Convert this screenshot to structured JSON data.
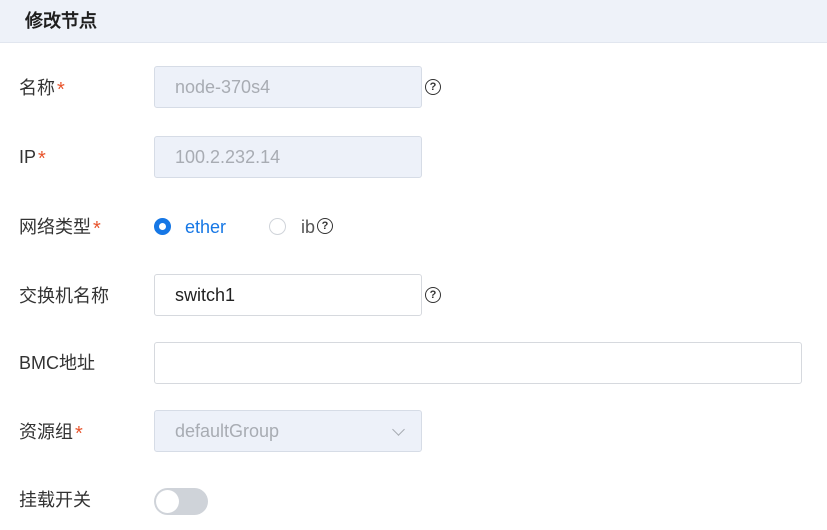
{
  "header": {
    "title": "修改节点"
  },
  "form": {
    "name": {
      "label": "名称",
      "required": "*",
      "value": "node-370s4",
      "help": "?"
    },
    "ip": {
      "label": "IP",
      "required": "*",
      "value": "100.2.232.14"
    },
    "network_type": {
      "label": "网络类型",
      "required": "*",
      "options": [
        {
          "label": "ether",
          "selected": true
        },
        {
          "label": "ib",
          "selected": false
        }
      ],
      "help": "?"
    },
    "switch_name": {
      "label": "交换机名称",
      "value": "switch1",
      "help": "?"
    },
    "bmc_address": {
      "label": "BMC地址",
      "value": ""
    },
    "resource_group": {
      "label": "资源组",
      "required": "*",
      "value": "defaultGroup"
    },
    "mount_switch": {
      "label": "挂载开关",
      "enabled": false
    }
  },
  "colors": {
    "accent": "#1677e5",
    "required": "#e8542c",
    "header_bg": "#eef2f9"
  }
}
